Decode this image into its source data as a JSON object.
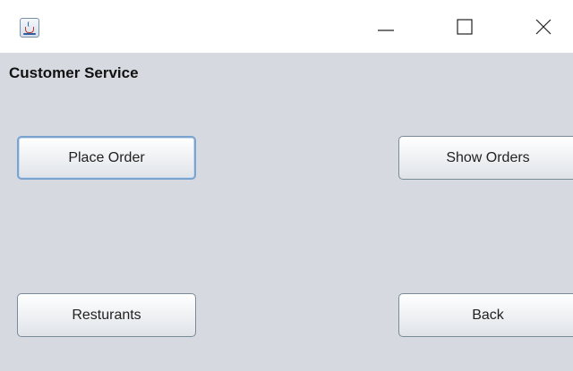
{
  "window": {
    "icons": {
      "app": "java-cup-icon",
      "minimize": "minimize-icon",
      "maximize": "maximize-icon",
      "close": "close-icon"
    }
  },
  "panel": {
    "title": "Customer Service",
    "buttons": {
      "place_order": "Place Order",
      "show_orders": "Show Orders",
      "restaurants": "Resturants",
      "back": "Back"
    }
  },
  "colors": {
    "panel_background": "#d6d9df",
    "focus_border": "#7aa3cf"
  }
}
